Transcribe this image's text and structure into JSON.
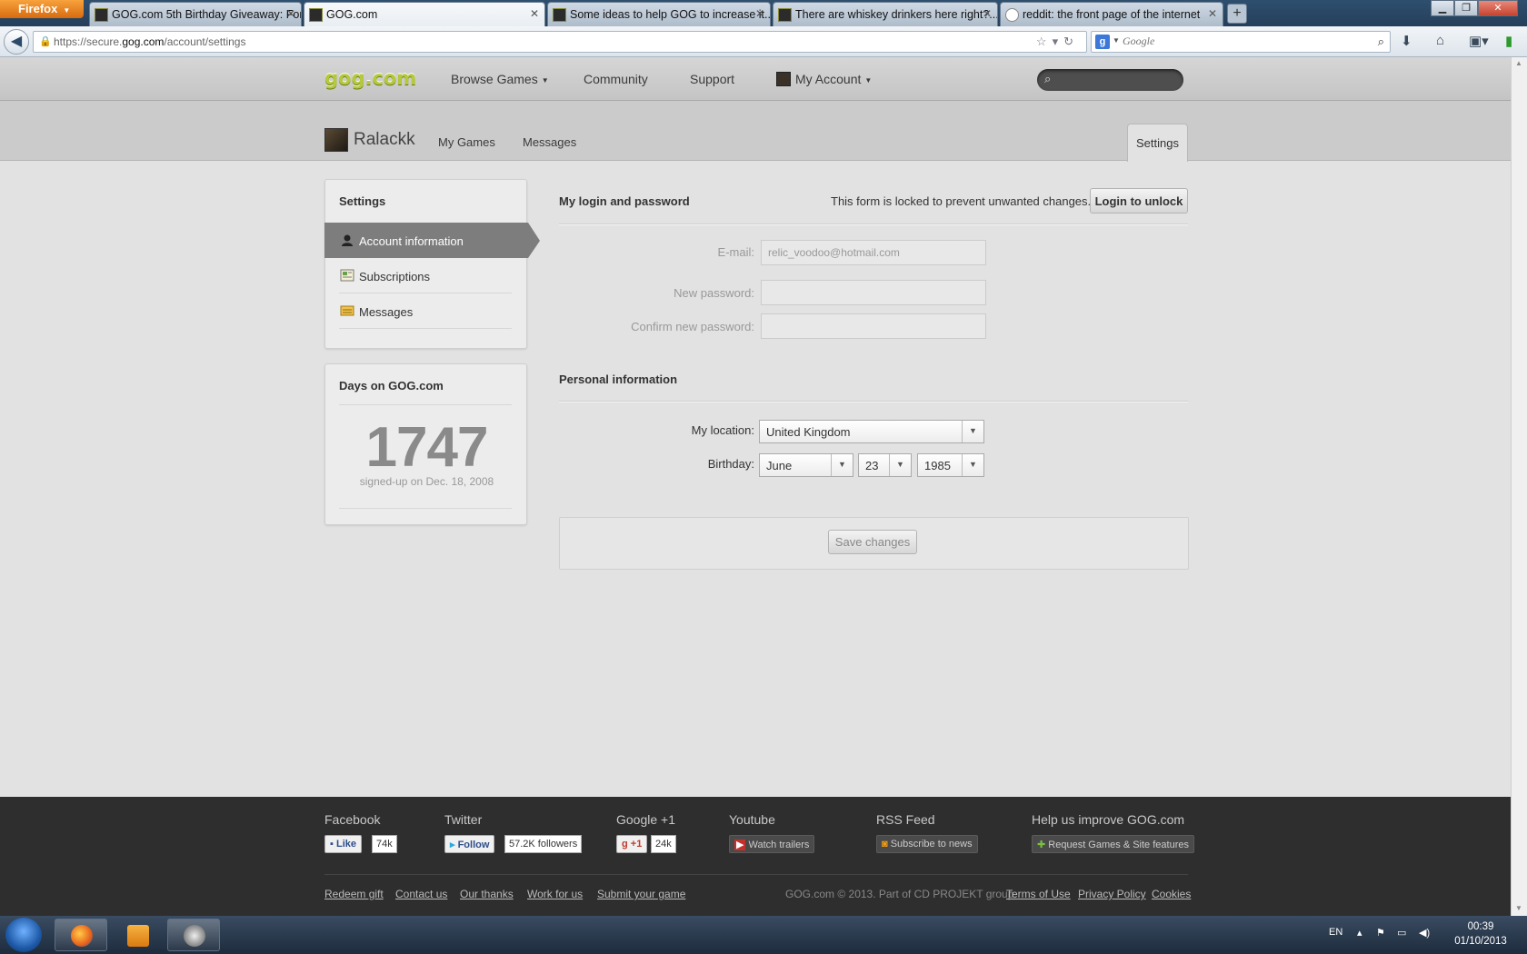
{
  "browser": {
    "menu_label": "Firefox",
    "tabs": [
      {
        "label": "GOG.com 5th Birthday Giveaway: For...",
        "active": false
      },
      {
        "label": "GOG.com",
        "active": true
      },
      {
        "label": "Some ideas to help GOG to increase it...",
        "active": false
      },
      {
        "label": "There are whiskey drinkers here right?...",
        "active": false
      },
      {
        "label": "reddit: the front page of the internet",
        "active": false
      }
    ],
    "url_prefix": "https://secure.",
    "url_domain": "gog.com",
    "url_path": "/account/settings",
    "search_placeholder": "Google"
  },
  "site": {
    "logo": "gog.com",
    "nav": {
      "browse": "Browse Games",
      "community": "Community",
      "support": "Support",
      "account": "My Account"
    },
    "subnav": {
      "username": "Ralackk",
      "my_games": "My Games",
      "messages": "Messages",
      "settings": "Settings"
    }
  },
  "sidebar": {
    "title": "Settings",
    "items": [
      {
        "label": "Account information",
        "icon": "user-icon",
        "active": true
      },
      {
        "label": "Subscriptions",
        "icon": "newsletter-icon",
        "active": false
      },
      {
        "label": "Messages",
        "icon": "envelope-icon",
        "active": false
      }
    ]
  },
  "days_panel": {
    "title": "Days on GOG.com",
    "days": "1747",
    "since": "signed-up on Dec. 18, 2008"
  },
  "login": {
    "heading": "My login and password",
    "locked_message": "This form is locked to prevent unwanted changes.",
    "unlock_button": "Login to unlock",
    "email_label": "E-mail:",
    "email_value": "relic_voodoo@hotmail.com",
    "new_password_label": "New password:",
    "confirm_password_label": "Confirm new password:"
  },
  "personal": {
    "heading": "Personal information",
    "location_label": "My location:",
    "location_value": "United Kingdom",
    "birthday_label": "Birthday:",
    "birth_month": "June",
    "birth_day": "23",
    "birth_year": "1985"
  },
  "save_button": "Save changes",
  "footer": {
    "facebook": {
      "heading": "Facebook",
      "button": "Like",
      "count": "74k"
    },
    "twitter": {
      "heading": "Twitter",
      "button": "Follow",
      "count": "57.2K followers"
    },
    "google": {
      "heading": "Google +1",
      "button": "+1",
      "count": "24k"
    },
    "youtube": {
      "heading": "Youtube",
      "button": "Watch trailers"
    },
    "rss": {
      "heading": "RSS Feed",
      "button": "Subscribe to news"
    },
    "improve": {
      "heading": "Help us improve GOG.com",
      "button": "Request Games & Site features"
    },
    "links": [
      "Redeem gift",
      "Contact us",
      "Our thanks",
      "Work for us",
      "Submit your game"
    ],
    "copyright": "GOG.com © 2013. Part of CD PROJEKT group.",
    "legal": [
      "Terms of Use",
      "Privacy Policy",
      "Cookies"
    ]
  },
  "taskbar": {
    "lang": "EN",
    "time": "00:39",
    "date": "01/10/2013"
  },
  "colors": {
    "gog_logo": "#b4c93b",
    "active_sidebar": "#7d7d7d",
    "footer_bg": "#2e2e2e"
  }
}
